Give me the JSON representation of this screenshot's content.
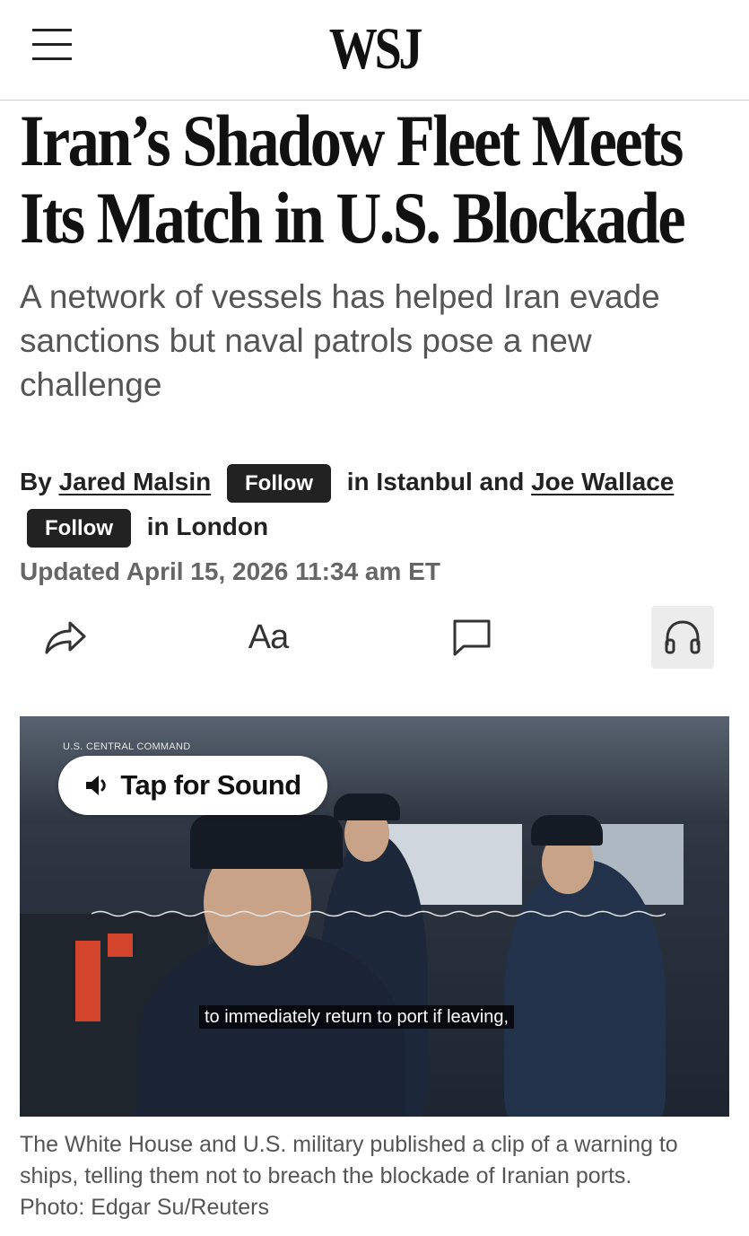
{
  "header": {
    "logo": "WSJ",
    "menu_icon": "hamburger-menu-icon"
  },
  "article": {
    "headline": "Iran’s Shadow Fleet Meets Its Match in U.S. Blockade",
    "dek": "A network of vessels has helped Iran evade sanctions but naval patrols pose a new challenge",
    "byline": {
      "prefix": "By",
      "author1": "Jared Malsin",
      "follow1": "Follow",
      "location1": "in Istanbul and",
      "author2": "Joe Wallace",
      "follow2": "Follow",
      "location2": "in London"
    },
    "updated": "Updated April 15, 2026 11:34 am ET"
  },
  "toolbar": {
    "share_icon": "share-icon",
    "text_size_label": "Aa",
    "comment_icon": "comment-icon",
    "listen_icon": "headphones-icon"
  },
  "media": {
    "source_tag": "U.S. CENTRAL COMMAND",
    "sound_label": "Tap for Sound",
    "sound_icon": "speaker-icon",
    "subtitle": "to immediately return to port if leaving,",
    "caption": "The White House and U.S. military published a clip of a warning to ships, telling them not to breach the blockade of Iranian ports.",
    "photo_credit": "Photo: Edgar Su/Reuters"
  }
}
